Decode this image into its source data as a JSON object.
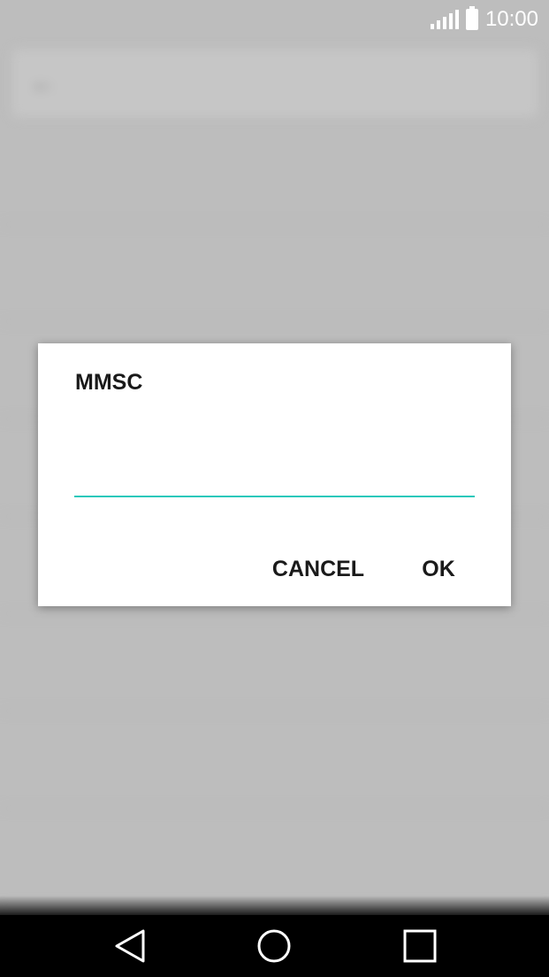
{
  "status_bar": {
    "time": "10:00",
    "icons": [
      "signal-icon",
      "battery-icon"
    ],
    "color": "#ffffff"
  },
  "dialog": {
    "title": "MMSC",
    "input": {
      "value": "",
      "placeholder": ""
    },
    "cancel_label": "CANCEL",
    "ok_label": "OK",
    "accent_color": "#2ac8bb"
  },
  "background_page": {
    "toolbar_title": "",
    "items": [
      {
        "title": "",
        "subtitle": ""
      },
      {
        "title": "",
        "subtitle": ""
      },
      {
        "title": "",
        "subtitle": ""
      },
      {
        "title": "",
        "subtitle": ""
      },
      {
        "title": "",
        "subtitle": ""
      },
      {
        "title": "",
        "subtitle": ""
      },
      {
        "title": "",
        "subtitle": ""
      },
      {
        "title": "",
        "subtitle": ""
      }
    ]
  },
  "nav_bar": {
    "icons": [
      "back-icon",
      "home-icon",
      "recents-icon"
    ],
    "background": "#000000"
  },
  "colors": {
    "overlay": "#bdbdbd",
    "dialog_bg": "#ffffff",
    "text": "#1a1a1a"
  }
}
